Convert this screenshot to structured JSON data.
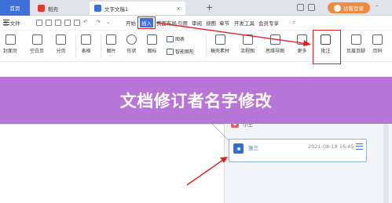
{
  "tabs": {
    "home": "首页",
    "wenku": "稻壳",
    "doc": "文字文稿1"
  },
  "login_label": "访客登录",
  "menu": {
    "file": "三 文件",
    "start": "开始",
    "insert": "插入",
    "layout": "页面布局",
    "ref": "引用",
    "review": "审阅",
    "view": "视图",
    "section": "章节",
    "dev": "开发工具",
    "member": "会员专享"
  },
  "ribbon": {
    "cover": "封面页",
    "blank": "空白页",
    "break": "分页",
    "table": "表格",
    "picture": "图片",
    "shape": "形状",
    "icon": "图标",
    "chart": "图表",
    "smart": "智能图形",
    "material": "稿壳素材",
    "flow": "流程图",
    "mind": "思维导图",
    "more": "更多",
    "comment": "批注",
    "header_footer": "页眉页脚",
    "page_num": "页码"
  },
  "banner_title": "文档修订者名字修改",
  "comments": {
    "prev_name": "小王",
    "name": "张三",
    "time": "2021-08-18 16:45"
  },
  "colors": {
    "accent_blue": "#3d6fd8",
    "highlight_red": "#e02020",
    "banner_purple": "#b775d7",
    "login_orange": "#f08a3c"
  }
}
